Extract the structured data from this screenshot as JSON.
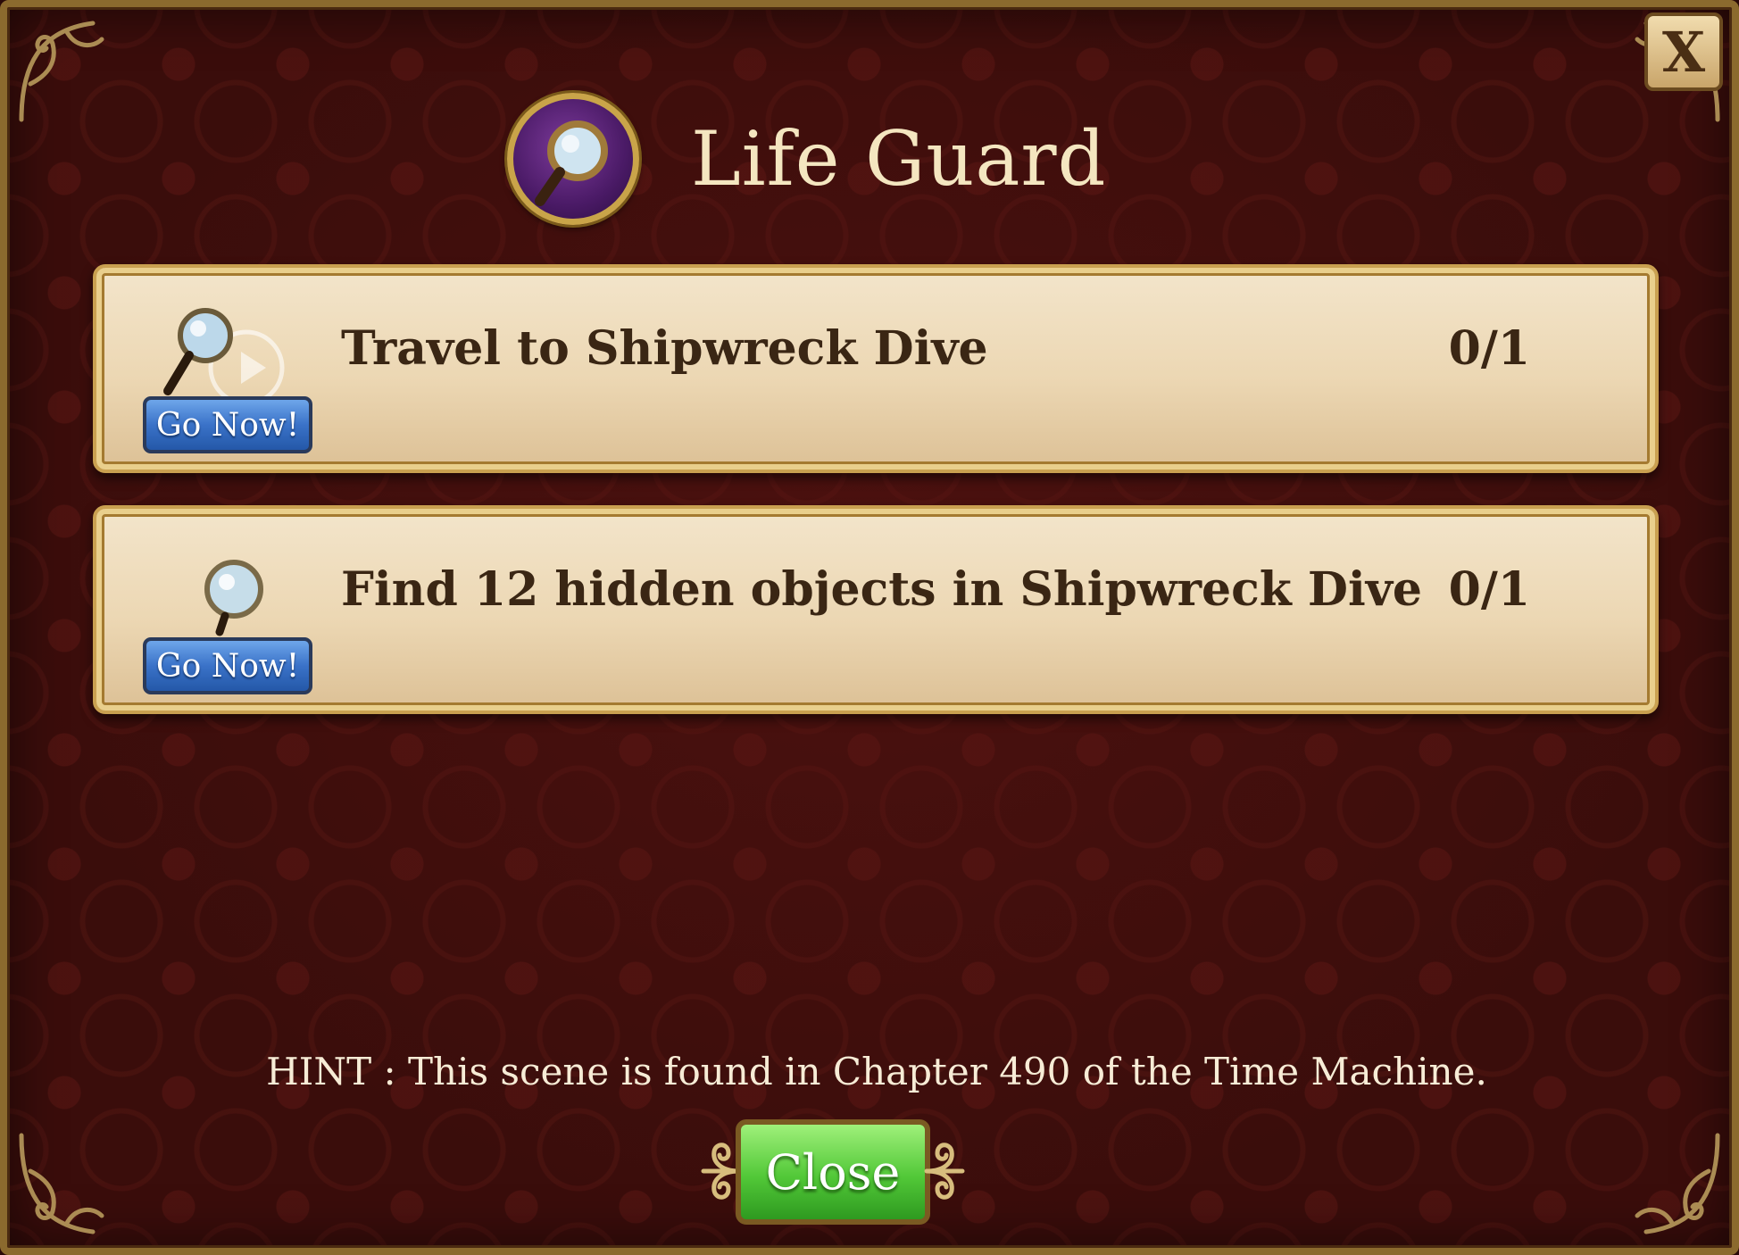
{
  "dialog": {
    "title": "Life Guard",
    "close_x_label": "X"
  },
  "tasks": [
    {
      "label": "Travel to Shipwreck Dive",
      "progress": "0/1",
      "button_label": "Go Now!",
      "icon": "magnifier-icon"
    },
    {
      "label": "Find 12 hidden objects in Shipwreck Dive",
      "progress": "0/1",
      "button_label": "Go Now!",
      "icon": "magnifier-icon"
    }
  ],
  "hint": "HINT : This scene is found in Chapter 490 of the Time Machine.",
  "footer": {
    "close_label": "Close"
  },
  "colors": {
    "background": "#3a0d0b",
    "gold_border": "#c9a050",
    "task_bg": "#ecd7b3",
    "go_button": "#3a72c8",
    "close_button": "#52c838"
  }
}
